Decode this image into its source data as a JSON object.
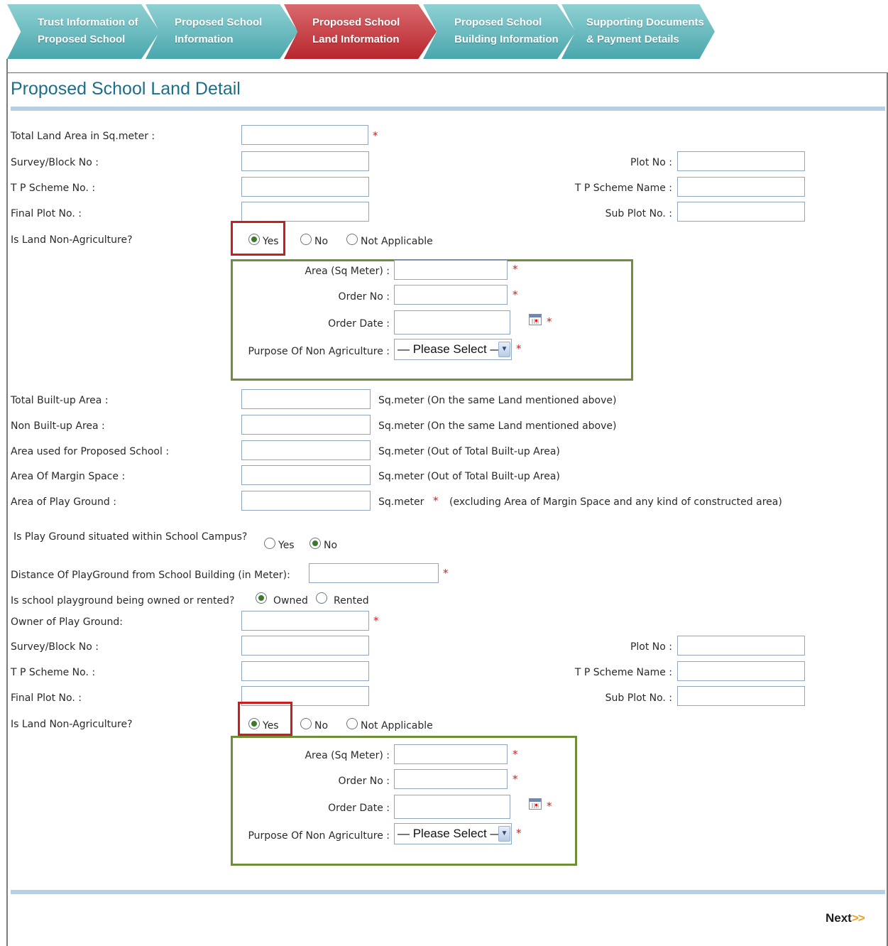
{
  "steps": [
    {
      "line1": "Trust Information of",
      "line2": "Proposed School",
      "active": false
    },
    {
      "line1": "Proposed School",
      "line2": "Information",
      "active": false
    },
    {
      "line1": "Proposed School",
      "line2": "Land Information",
      "active": true
    },
    {
      "line1": "Proposed School",
      "line2": "Building Information",
      "active": false
    },
    {
      "line1": "Supporting Documents",
      "line2": "& Payment Details",
      "active": false
    }
  ],
  "page_title": "Proposed School Land Detail",
  "required_mark": "*",
  "land": {
    "total_land_area_label": "Total Land Area in Sq.meter  :",
    "survey_label": "Survey/Block No :",
    "plot_label": "Plot No :",
    "tp_scheme_no_label": "T P Scheme No. :",
    "tp_scheme_name_label": "T P Scheme Name :",
    "final_plot_label": "Final Plot No. :",
    "sub_plot_label": "Sub Plot No. :",
    "non_agri_label": "Is Land Non-Agriculture?",
    "opt_yes": "Yes",
    "opt_no": "No",
    "opt_na": "Not Applicable",
    "selected": "Yes"
  },
  "na_box": {
    "area_label": "Area (Sq Meter) :",
    "order_no_label": "Order No :",
    "order_date_label": "Order Date :",
    "purpose_label": "Purpose Of Non Agriculture :",
    "purpose_value": "— Please Select —"
  },
  "builtup": {
    "total_label": "Total Built-up Area :",
    "total_note": "Sq.meter (On the same Land mentioned above)",
    "non_label": "Non Built-up Area :",
    "non_note": "Sq.meter (On the same Land mentioned above)",
    "school_label": "Area used for Proposed School :",
    "school_note": "Sq.meter (Out of Total Built-up Area)",
    "margin_label": "Area Of Margin Space :",
    "margin_note": "Sq.meter (Out of Total Built-up Area)",
    "play_label": "Area of Play Ground :",
    "play_unit": "Sq.meter",
    "play_note": "(excluding Area of Margin Space and any kind of constructed area)"
  },
  "playground": {
    "within_label": "Is Play Ground situated within School Campus?",
    "opt_yes": "Yes",
    "opt_no": "No",
    "within_selected": "No",
    "distance_label": "Distance Of PlayGround from School Building (in Meter):",
    "owned_label": "Is school playground being owned or rented?",
    "opt_owned": "Owned",
    "opt_rented": "Rented",
    "owned_selected": "Owned",
    "owner_label": "Owner of Play Ground:",
    "survey_label": "Survey/Block No :",
    "plot_label": "Plot No :",
    "tp_scheme_no_label": "T P Scheme No. :",
    "tp_scheme_name_label": "T P Scheme Name :",
    "final_plot_label": "Final Plot No. :",
    "sub_plot_label": "Sub Plot No. :",
    "non_agri_label": "Is Land Non-Agriculture?",
    "opt_na_yes": "Yes",
    "opt_na_no": "No",
    "opt_na_na": "Not Applicable",
    "non_agri_selected": "Yes"
  },
  "na_box2": {
    "area_label": "Area (Sq Meter) :",
    "order_no_label": "Order No :",
    "order_date_label": "Order Date :",
    "purpose_label": "Purpose Of Non Agriculture :",
    "purpose_value": "— Please Select —"
  },
  "next": {
    "label": "Next",
    "arrows": ">>"
  },
  "colors": {
    "step_teal": "#4aa7ad",
    "step_active": "#b8262d",
    "title": "#1a6f8a",
    "required": "#e01818",
    "highlight_red": "#cc1d1d",
    "highlight_green": "#6e8e3a"
  }
}
